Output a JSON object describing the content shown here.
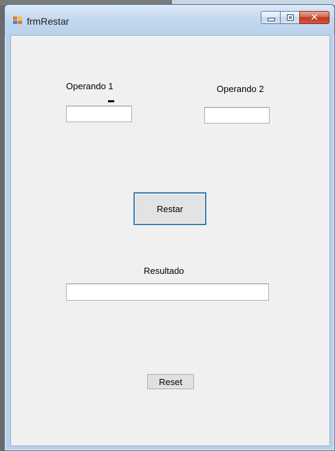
{
  "window": {
    "title": "frmRestar",
    "icon": "winforms-app-icon",
    "controls": {
      "minimize": "minimize-icon",
      "maximize": "maximize-icon",
      "close_glyph": "✕"
    }
  },
  "form": {
    "operando1_label": "Operando 1",
    "operando2_label": "Operando 2",
    "operator_symbol": "-",
    "operando1_value": "",
    "operando2_value": "",
    "restar_button": "Restar",
    "resultado_label": "Resultado",
    "resultado_value": "",
    "reset_button": "Reset"
  },
  "colors": {
    "titlebar": "#b9d1ea",
    "client_background": "#f0f0f0",
    "focused_button_border": "#3c7fb1",
    "close_button": "#c0391f"
  }
}
